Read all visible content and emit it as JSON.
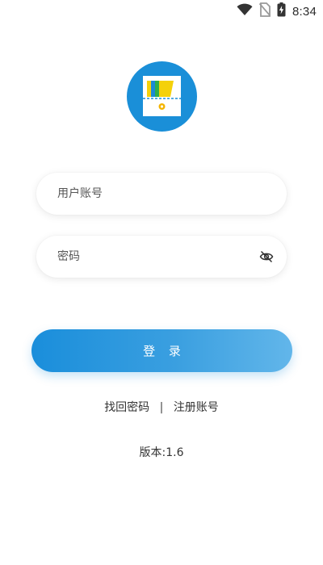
{
  "status_bar": {
    "time": "8:34",
    "icons": [
      "wifi-icon",
      "no-sim-icon",
      "battery-charging-icon"
    ]
  },
  "logo": {
    "icon": "app-logo-icon",
    "bg_color": "#1a8fd8"
  },
  "login_form": {
    "username_placeholder": "用户账号",
    "username_value": "",
    "password_placeholder": "密码",
    "password_value": "",
    "password_toggle_icon": "eye-hidden-icon",
    "submit_label": "登 录"
  },
  "links": {
    "forgot_password": "找回密码",
    "separator": "|",
    "register": "注册账号"
  },
  "version": "版本:1.6",
  "colors": {
    "accent": "#1a8edb",
    "accent_light": "#62b6ea"
  }
}
